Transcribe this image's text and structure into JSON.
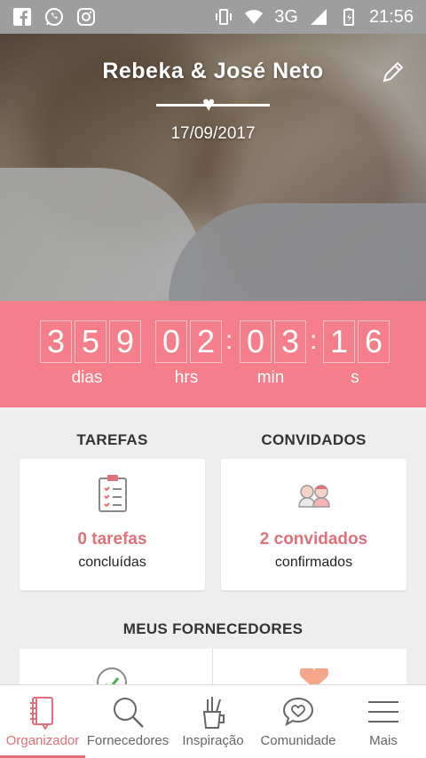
{
  "status_bar": {
    "time": "21:56",
    "network": "3G",
    "icons": [
      "facebook-icon",
      "whatsapp-icon",
      "instagram-icon",
      "vibrate-icon",
      "wifi-icon",
      "signal-icon",
      "battery-icon"
    ]
  },
  "hero": {
    "couple_names": "Rebeka & José Neto",
    "date": "17/09/2017"
  },
  "countdown": {
    "days": [
      "3",
      "5",
      "9"
    ],
    "hours": [
      "0",
      "2"
    ],
    "minutes": [
      "0",
      "3"
    ],
    "seconds": [
      "1",
      "6"
    ],
    "labels": {
      "days": "dias",
      "hours": "hrs",
      "minutes": "min",
      "seconds": "s"
    }
  },
  "tasks": {
    "title": "TAREFAS",
    "count": "0 tarefas",
    "subtitle": "concluídas"
  },
  "guests": {
    "title": "CONVIDADOS",
    "count": "2 convidados",
    "subtitle": "confirmados"
  },
  "providers": {
    "title": "MEUS FORNECEDORES"
  },
  "nav": [
    {
      "label": "Organizador",
      "icon": "notebook-icon",
      "active": true
    },
    {
      "label": "Fornecedores",
      "icon": "search-icon",
      "active": false
    },
    {
      "label": "Inspiração",
      "icon": "pencil-cup-icon",
      "active": false
    },
    {
      "label": "Comunidade",
      "icon": "chat-heart-icon",
      "active": false
    },
    {
      "label": "Mais",
      "icon": "menu-icon",
      "active": false
    }
  ],
  "colors": {
    "accent": "#e0707a",
    "countdown_bg": "#f47f8a",
    "status_bar": "#9e9e9e"
  }
}
